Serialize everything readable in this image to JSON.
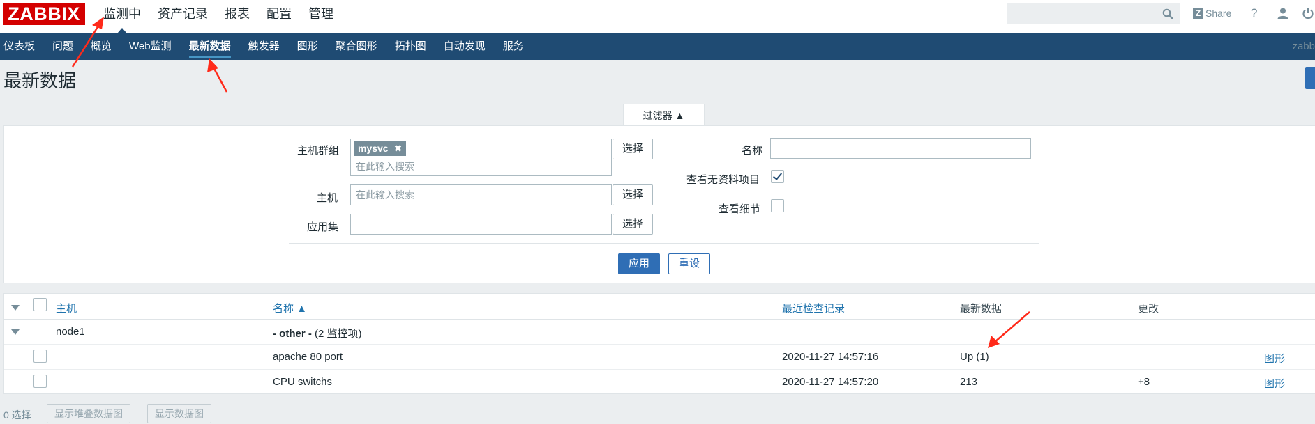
{
  "header": {
    "logo": "ZABBIX",
    "menu": [
      "监测中",
      "资产记录",
      "报表",
      "配置",
      "管理"
    ],
    "share": "Share",
    "help": "?"
  },
  "subnav": {
    "items": [
      "仪表板",
      "问题",
      "概览",
      "Web监测",
      "最新数据",
      "触发器",
      "图形",
      "聚合图形",
      "拓扑图",
      "自动发现",
      "服务"
    ],
    "right": "zabb"
  },
  "page": {
    "title": "最新数据"
  },
  "filter": {
    "tab_label": "过滤器 ▲",
    "hostgroup_label": "主机群组",
    "hostgroup_tag": "mysvc",
    "search_placeholder": "在此输入搜索",
    "host_label": "主机",
    "app_label": "应用集",
    "select_label": "选择",
    "name_label": "名称",
    "show_without_data_label": "查看无资料项目",
    "show_details_label": "查看细节",
    "apply": "应用",
    "reset": "重设"
  },
  "table": {
    "headers": {
      "host": "主机",
      "name": "名称 ▲",
      "last_check": "最近检查记录",
      "last_value": "最新数据",
      "change": "更改"
    },
    "group": {
      "host": "node1",
      "app": "- other -",
      "count": "(2 监控项)"
    },
    "rows": [
      {
        "name": "apache 80 port",
        "last_check": "2020-11-27 14:57:16",
        "last_value": "Up (1)",
        "change": "",
        "action": "图形"
      },
      {
        "name": "CPU switchs",
        "last_check": "2020-11-27 14:57:20",
        "last_value": "213",
        "change": "+8",
        "action": "图形"
      }
    ]
  },
  "footer": {
    "selected": "0 选择",
    "btn_stacked": "显示堆叠数据图",
    "btn_graph": "显示数据图"
  },
  "colors": {
    "brand": "#d40000",
    "nav": "#1f4b73",
    "link": "#1f73ad",
    "button": "#2f6eb5",
    "annotation": "#ff2a1a"
  }
}
